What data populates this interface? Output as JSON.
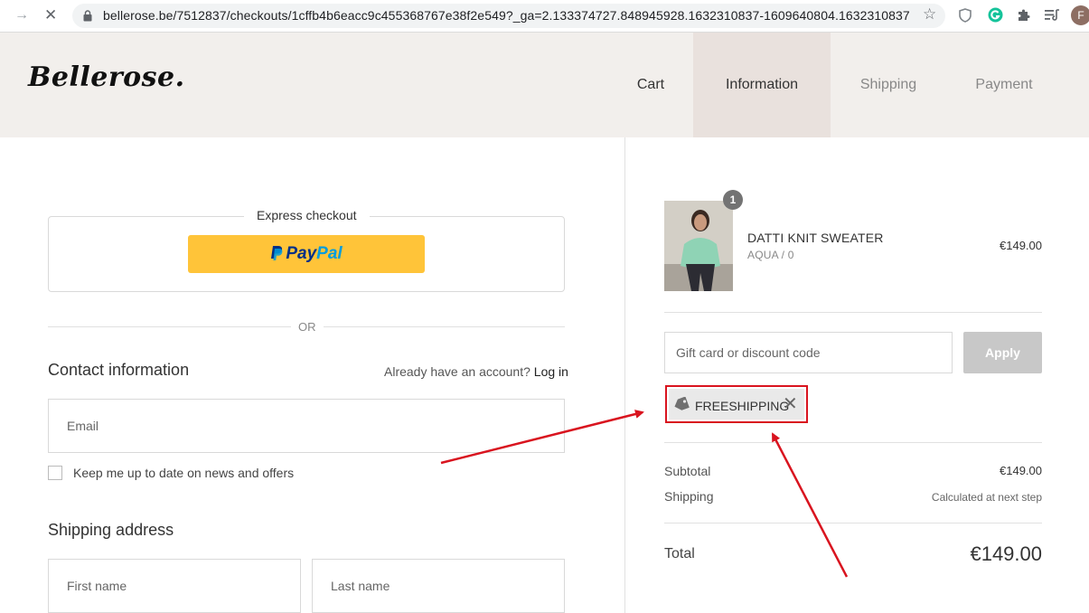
{
  "browser": {
    "url": "bellerose.be/7512837/checkouts/1cffb4b6eacc9c455368767e38f2e549?_ga=2.133374727.848945928.1632310837-1609640804.1632310837",
    "profile_initial": "F",
    "icons": [
      "forward-icon",
      "stop-icon",
      "lock-icon",
      "star-icon",
      "shield-icon",
      "grammarly-icon",
      "puzzle-icon",
      "playlist-icon"
    ]
  },
  "header": {
    "logo": "Bellerose.",
    "steps": [
      "Cart",
      "Information",
      "Shipping",
      "Payment"
    ],
    "active_step": "Information"
  },
  "express": {
    "label": "Express checkout",
    "paypal_part1": "Pay",
    "paypal_part2": "Pal",
    "button_color": "#ffc439"
  },
  "separator": "OR",
  "contact": {
    "title": "Contact information",
    "account_prompt": "Already have an account?",
    "login_link": "Log in",
    "email_placeholder": "Email",
    "newsletter_label": "Keep me up to date on news and offers"
  },
  "shipping_address": {
    "title": "Shipping address",
    "first_name_placeholder": "First name",
    "last_name_placeholder": "Last name"
  },
  "order": {
    "item": {
      "quantity": "1",
      "name": "DATTI KNIT SWEATER",
      "variant": "AQUA / 0",
      "price": "€149.00"
    },
    "discount": {
      "placeholder": "Gift card or discount code",
      "apply_label": "Apply",
      "applied_code": "FREESHIPPING",
      "remove_symbol": "✕"
    },
    "subtotal_label": "Subtotal",
    "subtotal_value": "€149.00",
    "shipping_label": "Shipping",
    "shipping_value": "Calculated at next step",
    "total_label": "Total",
    "total_value": "€149.00"
  },
  "colors": {
    "header_bg": "#f2efec",
    "active_step_bg": "#e9e1dd",
    "annotation_red": "#d9141f"
  }
}
